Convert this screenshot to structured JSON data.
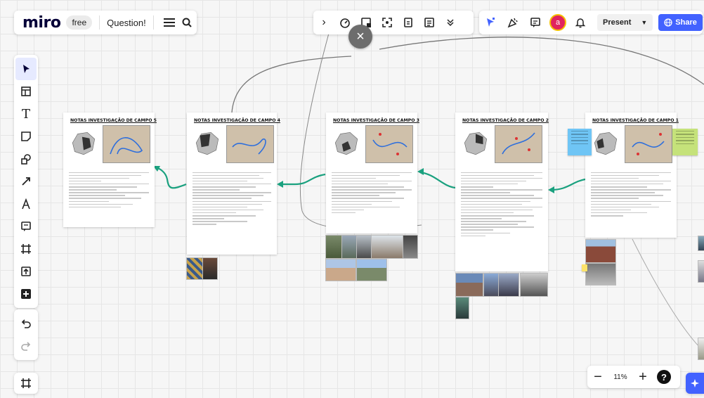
{
  "app": {
    "logo": "miro",
    "plan": "free",
    "board_name": "Question!"
  },
  "top_toolbar": {
    "collapse_icon": "chevron-right-icon",
    "items": [
      "timer-icon",
      "sticky-note-add-icon",
      "frame-focus-icon",
      "card-icon",
      "document-icon",
      "chevrons-down-icon"
    ]
  },
  "collab": {
    "avatar_initial": "a",
    "present_label": "Present",
    "share_label": "Share"
  },
  "left_toolbar": {
    "tools": [
      "select-cursor",
      "templates",
      "text",
      "sticky-note",
      "shapes",
      "connection-line",
      "pen",
      "comment",
      "frame",
      "upload",
      "more-apps",
      "undo",
      "redo"
    ]
  },
  "board": {
    "frame_titles": [
      "NOTAS INVESTIGAÇÃO DE CAMPO 5",
      "NOTAS INVESTIGAÇÃO DE CAMPO 4",
      "NOTAS INVESTIGAÇÃO DE CAMPO 3",
      "NOTAS INVESTIGAÇÃO DE CAMPO 2",
      "NOTAS INVESTIGAÇÃO DE CAMPO 1"
    ]
  },
  "zoom": {
    "level": "11%",
    "minus": "−",
    "plus": "+",
    "help": "?"
  },
  "colors": {
    "accent": "#4262ff",
    "arrow": "#1aa17f",
    "avatar": "#e0245e",
    "logo": "#050038"
  }
}
